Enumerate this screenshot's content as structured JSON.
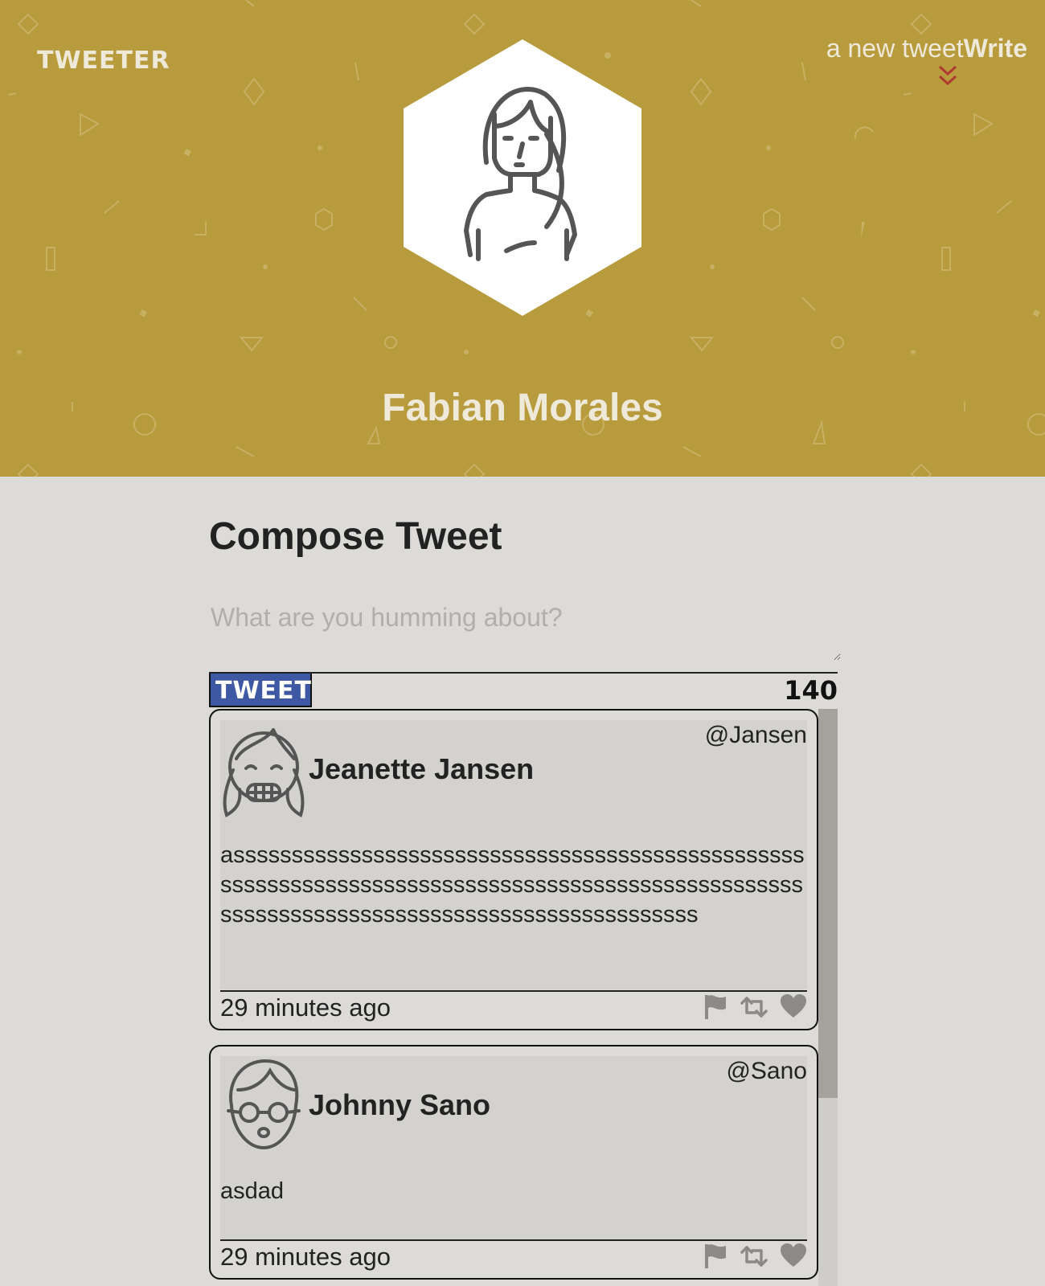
{
  "header": {
    "logo": "TWEETER",
    "write_prefix": "a new tweet",
    "write_strong": "Write",
    "user_name": "Fabian Morales",
    "colors": {
      "banner": "#b79b3c",
      "accent_red": "#b03a32"
    }
  },
  "compose": {
    "title": "Compose Tweet",
    "placeholder": "What are you humming about?",
    "value": "",
    "button_label": "TWEET",
    "counter": "140",
    "button_color": "#3e58a4"
  },
  "tweets": [
    {
      "name": "Jeanette Jansen",
      "handle": "@Jansen",
      "text": "assssssssssssssssssssssssssssssssssssssssssssssssssssssssssssssssssssssssssssssssssssssssssssssssssssssssssssssssssssssssssssssssssssssssssss",
      "time": "29 minutes ago",
      "avatar_icon": "girl-laughing-avatar-icon"
    },
    {
      "name": "Johnny Sano",
      "handle": "@Sano",
      "text": "asdad",
      "time": "29 minutes ago",
      "avatar_icon": "boy-glasses-avatar-icon"
    }
  ],
  "icons": {
    "flag": "flag-icon",
    "retweet": "retweet-icon",
    "like": "heart-icon",
    "write": "chevron-double-down-icon"
  }
}
